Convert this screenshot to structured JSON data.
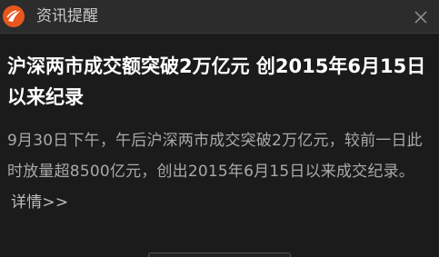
{
  "window": {
    "title": "资讯提醒",
    "logo_icon": "app-logo-icon",
    "close_icon": "close-icon",
    "accent_color": "#e8571e"
  },
  "article": {
    "headline": "沪深两市成交额突破2万亿元 创2015年6月15日以来纪录",
    "body": "9月30日下午，午后沪深两市成交突破2万亿元，较前一日此时放量超8500亿元，创出2015年6月15日以来成交纪录。",
    "more_link": "详情>>"
  }
}
